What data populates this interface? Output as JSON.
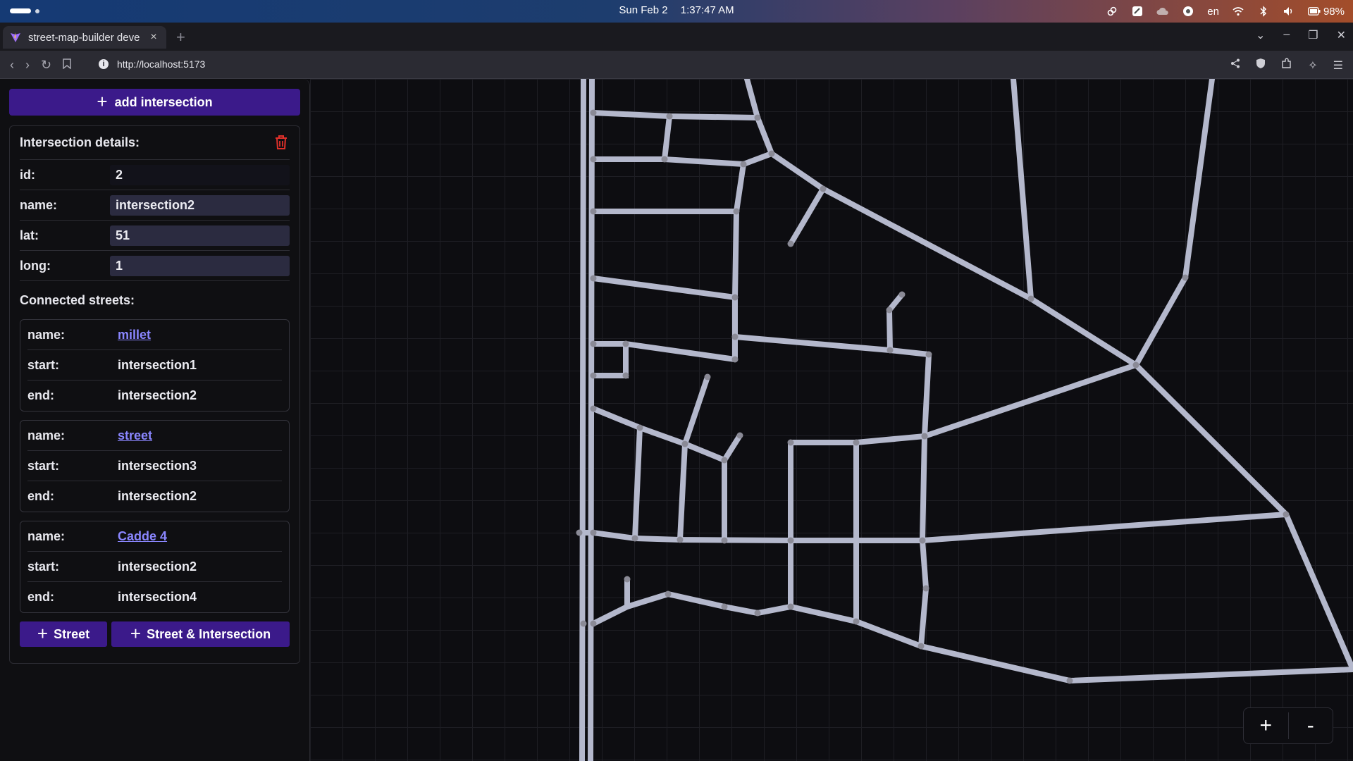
{
  "os": {
    "date": "Sun Feb 2",
    "time": "1:37:47 AM",
    "lang": "en",
    "battery": "98%"
  },
  "browser": {
    "tab_title": "street-map-builder deve",
    "url": "http://localhost:5173"
  },
  "sidebar": {
    "add_intersection_label": "add intersection",
    "details_title": "Intersection details:",
    "fields": [
      {
        "label": "id:",
        "value": "2"
      },
      {
        "label": "name:",
        "value": "intersection2"
      },
      {
        "label": "lat:",
        "value": "51"
      },
      {
        "label": "long:",
        "value": "1"
      }
    ],
    "connected_title": "Connected streets:",
    "streets": [
      {
        "name_label": "name:",
        "name": "millet",
        "start_label": "start:",
        "start": "intersection1",
        "end_label": "end:",
        "end": "intersection2"
      },
      {
        "name_label": "name:",
        "name": "street",
        "start_label": "start:",
        "start": "intersection3",
        "end_label": "end:",
        "end": "intersection2"
      },
      {
        "name_label": "name:",
        "name": "Cadde 4",
        "start_label": "start:",
        "start": "intersection2",
        "end_label": "end:",
        "end": "intersection4"
      }
    ],
    "street_button_label": "Street",
    "street_intersection_button_label": "Street & Intersection"
  },
  "map": {
    "zoom_in_label": "+",
    "zoom_out_label": "-",
    "colors": {
      "street": "#b4b8cc",
      "node": "#8a8a96",
      "selected": "#3aa24a",
      "accent": "#3b1a8a"
    }
  }
}
